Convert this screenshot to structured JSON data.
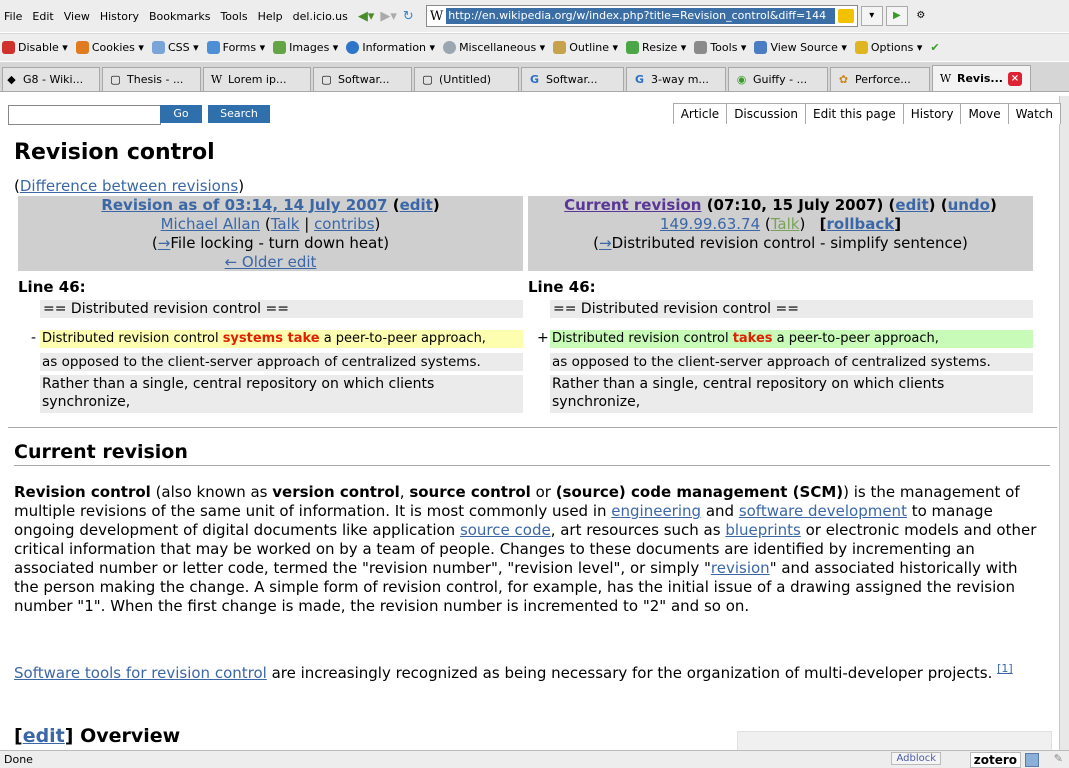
{
  "menubar": {
    "items": [
      "File",
      "Edit",
      "View",
      "History",
      "Bookmarks",
      "Tools",
      "Help",
      "del.icio.us"
    ],
    "url": "http://en.wikipedia.org/w/index.php?title=Revision_control&diff=144"
  },
  "devbar": {
    "items": [
      {
        "label": "Disable",
        "color": "#d0312d"
      },
      {
        "label": "Cookies",
        "color": "#e07b1f"
      },
      {
        "label": "CSS",
        "color": "#7aa3d8"
      },
      {
        "label": "Forms",
        "color": "#4d8fd6"
      },
      {
        "label": "Images",
        "color": "#63a545"
      },
      {
        "label": "Information",
        "color": "#2e74c8"
      },
      {
        "label": "Miscellaneous",
        "color": "#9aa6b2"
      },
      {
        "label": "Outline",
        "color": "#c7a24c"
      },
      {
        "label": "Resize",
        "color": "#4ba645"
      },
      {
        "label": "Tools",
        "color": "#8a8a8a"
      },
      {
        "label": "View Source",
        "color": "#4a7dc4"
      },
      {
        "label": "Options",
        "color": "#e0b620"
      }
    ]
  },
  "tabs": [
    {
      "label": "G8 - Wiki...",
      "icon": "◆"
    },
    {
      "label": "Thesis - ...",
      "icon": "▢"
    },
    {
      "label": "Lorem ip...",
      "icon": "W"
    },
    {
      "label": "Softwar...",
      "icon": "▢"
    },
    {
      "label": "(Untitled)",
      "icon": "▢"
    },
    {
      "label": "Softwar...",
      "icon": "G"
    },
    {
      "label": "3-way m...",
      "icon": "G"
    },
    {
      "label": "Guiffy - ...",
      "icon": "◉"
    },
    {
      "label": "Perforce...",
      "icon": "✿"
    },
    {
      "label": "Revis...",
      "icon": "W"
    }
  ],
  "wiki": {
    "go_label": "Go",
    "search_label": "Search",
    "page_tabs": [
      "Article",
      "Discussion",
      "Edit this page",
      "History",
      "Move",
      "Watch"
    ]
  },
  "page": {
    "title": "Revision control",
    "diff_open": "(",
    "diff_link": "Difference between revisions",
    "diff_close": ")"
  },
  "diff": {
    "left": {
      "rev_link": "Revision as of 03:14, 14 July 2007",
      "edit": "edit",
      "user": "Michael Allan",
      "talk": "Talk",
      "contribs": "contribs",
      "summary_arrow": "→",
      "summary": "File locking - turn down heat",
      "older": "← Older edit",
      "line": "Line 46:"
    },
    "right": {
      "rev_link": "Current revision",
      "rev_time": "(07:10, 15 July 2007)",
      "edit": "edit",
      "undo": "undo",
      "user": "149.99.63.74",
      "talk": "Talk",
      "rollback": "rollback",
      "summary_arrow": "→",
      "summary": "Distributed revision control - simplify sentence",
      "line": "Line 46:"
    },
    "context1": "== Distributed revision control ==",
    "left_changed": {
      "pre": "Distributed revision control ",
      "hl": "systems take",
      "post": " a peer-to-peer approach,"
    },
    "right_changed": {
      "pre": "Distributed revision control ",
      "hl": "takes",
      "post": " a peer-to-peer approach,"
    },
    "context2": "as opposed to the client-server approach of centralized systems.",
    "context3": "Rather than a single, central repository on which clients synchronize,",
    "minus": "-",
    "plus": "+"
  },
  "current": {
    "heading": "Current revision",
    "p1": {
      "b1": "Revision control",
      "t1": " (also known as ",
      "b2": "version control",
      "t2": ", ",
      "b3": "source control",
      "t3": " or ",
      "b4": "(source) code management (SCM)",
      "t4": ") is the management of multiple revisions of the same unit of information. It is most commonly used in ",
      "l1": "engineering",
      "t5": " and ",
      "l2": "software development",
      "t6": " to manage ongoing development of digital documents like application ",
      "l3": "source code",
      "t7": ", art resources such as ",
      "l4": "blueprints",
      "t8": " or electronic models and other critical information that may be worked on by a team of people. Changes to these documents are identified by incrementing an associated number or letter code, termed the \"revision number\", \"revision level\", or simply \"",
      "l5": "revision",
      "t9": "\" and associated historically with the person making the change. A simple form of revision control, for example, has the initial issue of a drawing assigned the revision number \"1\". When the first change is made, the revision number is incremented to \"2\" and so on."
    },
    "p2": {
      "l1": "Software tools for revision control",
      "t1": " are increasingly recognized as being necessary for the organization of multi-developer projects. ",
      "ref": "[1]"
    }
  },
  "overview": {
    "edit_open": "[",
    "edit": "edit",
    "edit_close": "]",
    "heading": " Overview"
  },
  "status": {
    "text": "Done",
    "adblock": "Adblock",
    "zotero": "zotero"
  }
}
